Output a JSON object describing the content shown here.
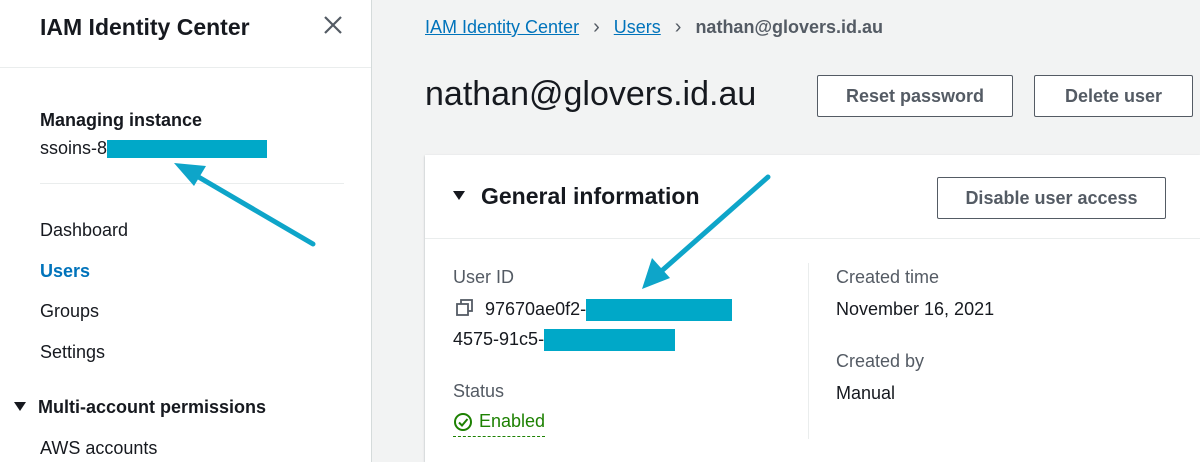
{
  "sidebar": {
    "title": "IAM Identity Center",
    "managing_label": "Managing instance",
    "instance_prefix": "ssoins-8",
    "nav": [
      {
        "label": "Dashboard"
      },
      {
        "label": "Users"
      },
      {
        "label": "Groups"
      },
      {
        "label": "Settings"
      }
    ],
    "section_label": "Multi-account permissions",
    "section_items": [
      {
        "label": "AWS accounts"
      }
    ]
  },
  "breadcrumb": {
    "items": [
      {
        "label": "IAM Identity Center"
      },
      {
        "label": "Users"
      }
    ],
    "current": "nathan@glovers.id.au"
  },
  "header": {
    "title": "nathan@glovers.id.au",
    "reset_label": "Reset password",
    "delete_label": "Delete user"
  },
  "general": {
    "title": "General information",
    "disable_label": "Disable user access",
    "user_id_label": "User ID",
    "user_id_line1": "97670ae0f2-",
    "user_id_line2": "4575-91c5-",
    "status_label": "Status",
    "status_value": "Enabled",
    "created_time_label": "Created time",
    "created_time_value": "November 16, 2021",
    "created_by_label": "Created by",
    "created_by_value": "Manual"
  },
  "colors": {
    "link": "#0073bb",
    "success": "#1d8102",
    "annotation": "#0ea5c9"
  }
}
